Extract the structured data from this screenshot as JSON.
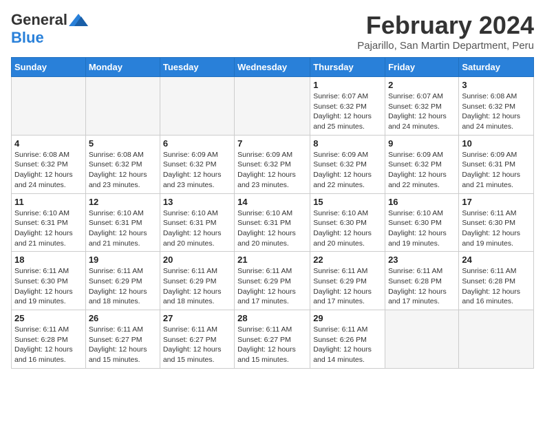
{
  "logo": {
    "general": "General",
    "blue": "Blue"
  },
  "title": {
    "month": "February 2024",
    "location": "Pajarillo, San Martin Department, Peru"
  },
  "headers": [
    "Sunday",
    "Monday",
    "Tuesday",
    "Wednesday",
    "Thursday",
    "Friday",
    "Saturday"
  ],
  "weeks": [
    [
      {
        "day": "",
        "info": ""
      },
      {
        "day": "",
        "info": ""
      },
      {
        "day": "",
        "info": ""
      },
      {
        "day": "",
        "info": ""
      },
      {
        "day": "1",
        "info": "Sunrise: 6:07 AM\nSunset: 6:32 PM\nDaylight: 12 hours and 25 minutes."
      },
      {
        "day": "2",
        "info": "Sunrise: 6:07 AM\nSunset: 6:32 PM\nDaylight: 12 hours and 24 minutes."
      },
      {
        "day": "3",
        "info": "Sunrise: 6:08 AM\nSunset: 6:32 PM\nDaylight: 12 hours and 24 minutes."
      }
    ],
    [
      {
        "day": "4",
        "info": "Sunrise: 6:08 AM\nSunset: 6:32 PM\nDaylight: 12 hours and 24 minutes."
      },
      {
        "day": "5",
        "info": "Sunrise: 6:08 AM\nSunset: 6:32 PM\nDaylight: 12 hours and 23 minutes."
      },
      {
        "day": "6",
        "info": "Sunrise: 6:09 AM\nSunset: 6:32 PM\nDaylight: 12 hours and 23 minutes."
      },
      {
        "day": "7",
        "info": "Sunrise: 6:09 AM\nSunset: 6:32 PM\nDaylight: 12 hours and 23 minutes."
      },
      {
        "day": "8",
        "info": "Sunrise: 6:09 AM\nSunset: 6:32 PM\nDaylight: 12 hours and 22 minutes."
      },
      {
        "day": "9",
        "info": "Sunrise: 6:09 AM\nSunset: 6:32 PM\nDaylight: 12 hours and 22 minutes."
      },
      {
        "day": "10",
        "info": "Sunrise: 6:09 AM\nSunset: 6:31 PM\nDaylight: 12 hours and 21 minutes."
      }
    ],
    [
      {
        "day": "11",
        "info": "Sunrise: 6:10 AM\nSunset: 6:31 PM\nDaylight: 12 hours and 21 minutes."
      },
      {
        "day": "12",
        "info": "Sunrise: 6:10 AM\nSunset: 6:31 PM\nDaylight: 12 hours and 21 minutes."
      },
      {
        "day": "13",
        "info": "Sunrise: 6:10 AM\nSunset: 6:31 PM\nDaylight: 12 hours and 20 minutes."
      },
      {
        "day": "14",
        "info": "Sunrise: 6:10 AM\nSunset: 6:31 PM\nDaylight: 12 hours and 20 minutes."
      },
      {
        "day": "15",
        "info": "Sunrise: 6:10 AM\nSunset: 6:30 PM\nDaylight: 12 hours and 20 minutes."
      },
      {
        "day": "16",
        "info": "Sunrise: 6:10 AM\nSunset: 6:30 PM\nDaylight: 12 hours and 19 minutes."
      },
      {
        "day": "17",
        "info": "Sunrise: 6:11 AM\nSunset: 6:30 PM\nDaylight: 12 hours and 19 minutes."
      }
    ],
    [
      {
        "day": "18",
        "info": "Sunrise: 6:11 AM\nSunset: 6:30 PM\nDaylight: 12 hours and 19 minutes."
      },
      {
        "day": "19",
        "info": "Sunrise: 6:11 AM\nSunset: 6:29 PM\nDaylight: 12 hours and 18 minutes."
      },
      {
        "day": "20",
        "info": "Sunrise: 6:11 AM\nSunset: 6:29 PM\nDaylight: 12 hours and 18 minutes."
      },
      {
        "day": "21",
        "info": "Sunrise: 6:11 AM\nSunset: 6:29 PM\nDaylight: 12 hours and 17 minutes."
      },
      {
        "day": "22",
        "info": "Sunrise: 6:11 AM\nSunset: 6:29 PM\nDaylight: 12 hours and 17 minutes."
      },
      {
        "day": "23",
        "info": "Sunrise: 6:11 AM\nSunset: 6:28 PM\nDaylight: 12 hours and 17 minutes."
      },
      {
        "day": "24",
        "info": "Sunrise: 6:11 AM\nSunset: 6:28 PM\nDaylight: 12 hours and 16 minutes."
      }
    ],
    [
      {
        "day": "25",
        "info": "Sunrise: 6:11 AM\nSunset: 6:28 PM\nDaylight: 12 hours and 16 minutes."
      },
      {
        "day": "26",
        "info": "Sunrise: 6:11 AM\nSunset: 6:27 PM\nDaylight: 12 hours and 15 minutes."
      },
      {
        "day": "27",
        "info": "Sunrise: 6:11 AM\nSunset: 6:27 PM\nDaylight: 12 hours and 15 minutes."
      },
      {
        "day": "28",
        "info": "Sunrise: 6:11 AM\nSunset: 6:27 PM\nDaylight: 12 hours and 15 minutes."
      },
      {
        "day": "29",
        "info": "Sunrise: 6:11 AM\nSunset: 6:26 PM\nDaylight: 12 hours and 14 minutes."
      },
      {
        "day": "",
        "info": ""
      },
      {
        "day": "",
        "info": ""
      }
    ]
  ]
}
